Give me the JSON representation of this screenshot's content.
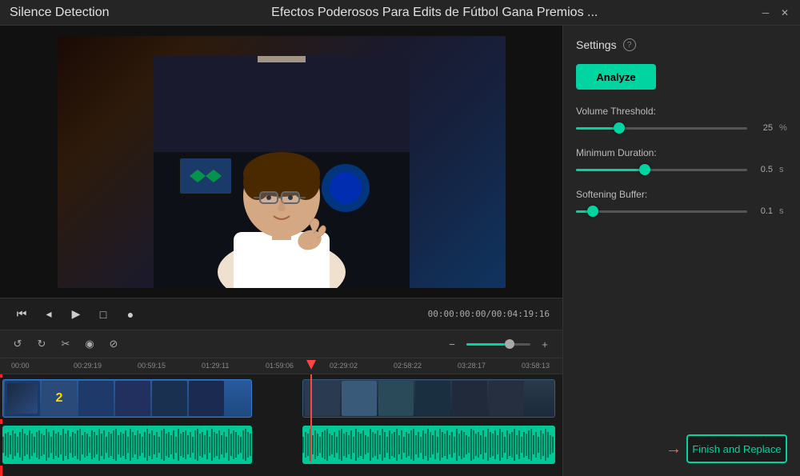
{
  "titlebar": {
    "app_title": "Silence Detection",
    "video_title": "Efectos Poderosos Para Edits de Fútbol   Gana Premios ...",
    "minimize_label": "─",
    "close_label": "✕"
  },
  "playback": {
    "timecode": "00:00:00:00/00:04:19:16"
  },
  "settings": {
    "title": "Settings",
    "analyze_label": "Analyze",
    "volume_threshold_label": "Volume Threshold:",
    "volume_value": "25",
    "volume_unit": "%",
    "volume_percent": 25,
    "min_duration_label": "Minimum Duration:",
    "min_duration_value": "0.5",
    "min_duration_unit": "s",
    "min_duration_percent": 40,
    "softening_label": "Softening Buffer:",
    "softening_value": "0.1",
    "softening_unit": "s",
    "softening_percent": 10
  },
  "finish_button": {
    "label": "Finish and Replace"
  },
  "timeline": {
    "markers": [
      {
        "time": "00:00",
        "pos": 14
      },
      {
        "time": "00:29:19",
        "pos": 92
      },
      {
        "time": "00:59:15",
        "pos": 172
      },
      {
        "time": "01:29:11",
        "pos": 252
      },
      {
        "time": "01:59:06",
        "pos": 332
      },
      {
        "time": "02:29:02",
        "pos": 412
      },
      {
        "time": "02:58:22",
        "pos": 492
      },
      {
        "time": "03:28:17",
        "pos": 572
      },
      {
        "time": "03:58:13",
        "pos": 652
      }
    ]
  },
  "icons": {
    "undo": "↺",
    "redo": "↻",
    "scissors": "✂",
    "eye": "◉",
    "mute": "⊘",
    "step_back": "⏮",
    "play_back": "◂",
    "play": "▶",
    "stop": "□",
    "record": "●",
    "zoom_out": "−",
    "zoom_in": "+"
  }
}
